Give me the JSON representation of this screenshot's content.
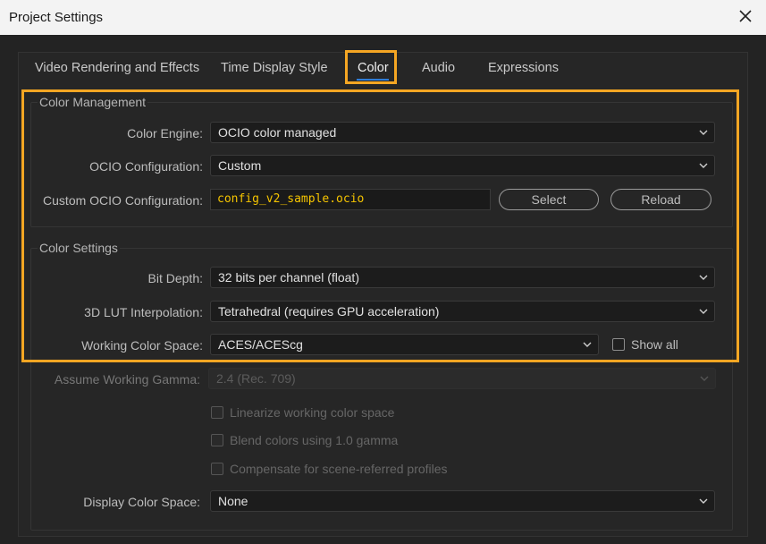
{
  "window": {
    "title": "Project Settings"
  },
  "tabs": [
    {
      "label": "Video Rendering and Effects"
    },
    {
      "label": "Time Display Style"
    },
    {
      "label": "Color",
      "active": true
    },
    {
      "label": "Audio"
    },
    {
      "label": "Expressions"
    }
  ],
  "color_management": {
    "title": "Color Management",
    "color_engine": {
      "label": "Color Engine:",
      "value": "OCIO color managed"
    },
    "ocio_configuration": {
      "label": "OCIO Configuration:",
      "value": "Custom"
    },
    "custom_ocio": {
      "label": "Custom OCIO Configuration:",
      "value": "config_v2_sample.ocio"
    },
    "select_label": "Select",
    "reload_label": "Reload"
  },
  "color_settings": {
    "title": "Color Settings",
    "bit_depth": {
      "label": "Bit Depth:",
      "value": "32 bits per channel (float)"
    },
    "lut_interpolation": {
      "label": "3D LUT Interpolation:",
      "value": "Tetrahedral (requires GPU acceleration)"
    },
    "working_color_space": {
      "label": "Working Color Space:",
      "value": "ACES/ACEScg"
    },
    "show_all_label": "Show all",
    "assume_gamma": {
      "label": "Assume Working Gamma:",
      "value": "2.4 (Rec. 709)"
    },
    "linearize_label": "Linearize working color space",
    "blend_label": "Blend colors using 1.0 gamma",
    "compensate_label": "Compensate for scene-referred profiles",
    "display_color_space": {
      "label": "Display Color Space:",
      "value": "None"
    }
  },
  "colors": {
    "accent": "#2f7cd6",
    "highlight": "#f5a623",
    "config_text": "#f5c400"
  },
  "icons": {
    "close": "close-icon",
    "dropdown": "chevron-down-icon"
  }
}
